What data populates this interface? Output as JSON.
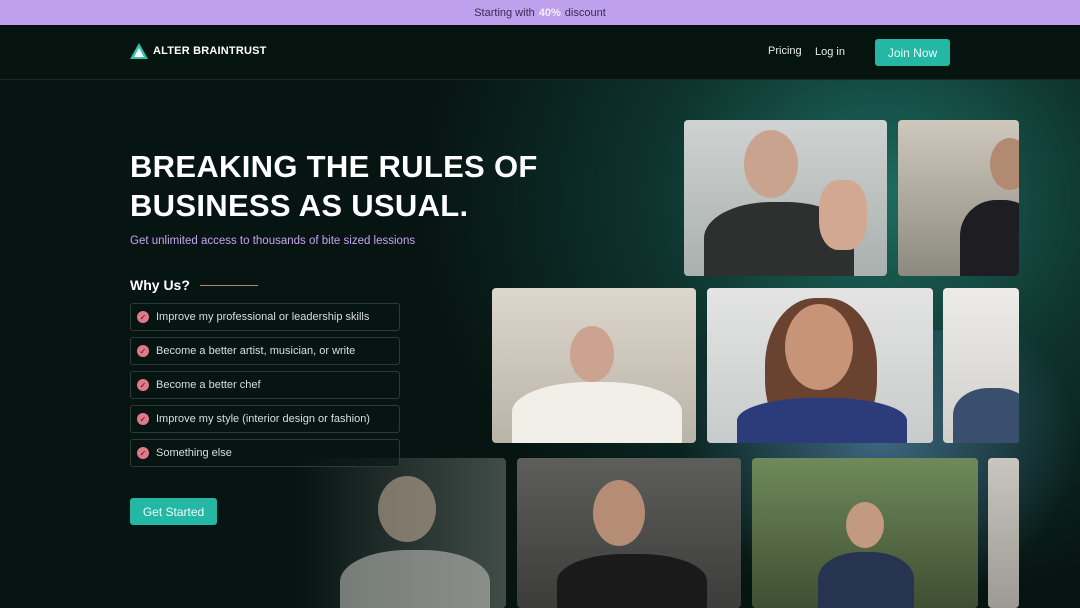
{
  "promo": {
    "prefix": "Starting with",
    "percent": "40%",
    "suffix": "discount"
  },
  "nav": {
    "brand": "ALTER BRAINTRUST",
    "links": [
      "Pricing",
      "Log in"
    ],
    "cta": "Join Now"
  },
  "hero": {
    "title_line1": "BREAKING THE RULES OF",
    "title_line2": "BUSINESS AS USUAL.",
    "subtitle": "Get unlimited access to thousands of bite sized lessions"
  },
  "why": {
    "heading": "Why Us?",
    "options": [
      "Improve my professional or leadership skills",
      "Become a better artist, musician, or write",
      "Become a better chef",
      "Improve my style (interior design or fashion)",
      "Something else"
    ]
  },
  "cta": {
    "label": "Get Started"
  },
  "colors": {
    "accent": "#23b7a4",
    "promo_bg": "#bea0ec",
    "subtitle": "#c5a3f0",
    "check": "#e07a8a",
    "background": "#071512"
  }
}
